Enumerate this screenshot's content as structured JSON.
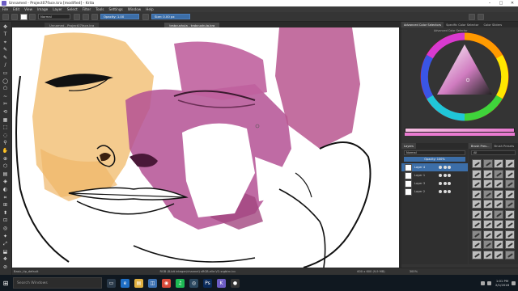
{
  "window": {
    "title": "Unnamed - Project07face.kra [modified] - Krita",
    "minimize": "–",
    "maximize": "□",
    "close": "✕"
  },
  "menu": [
    "File",
    "Edit",
    "View",
    "Image",
    "Layer",
    "Select",
    "Filter",
    "Tools",
    "Settings",
    "Window",
    "Help"
  ],
  "options": {
    "blend_mode": "Normal",
    "opacity": "Opacity: 1.00",
    "size": "Size: 0.00 px"
  },
  "tools": [
    "✥",
    "T",
    "⌖",
    "✎",
    "✎",
    "/",
    "▭",
    "◯",
    "⬠",
    "~",
    "✂",
    "⟲",
    "▦",
    "⬚",
    "◌",
    "⚲",
    "✋",
    "⊕",
    "⬡",
    "▤",
    "◈",
    "◐",
    "⌗",
    "⊞",
    "⬍",
    "⊡",
    "◎",
    "✦",
    "⤢",
    "⬓",
    "❖",
    "⊘"
  ],
  "doc_tabs": [
    "Unnamed - Project07face.kra",
    "trabcushula - trabcushula.kra"
  ],
  "status": {
    "brush": "Basic_tip_default",
    "color": "RGB (8-bit integer/channel) sRGB-elle-V2-srgbtrc.icc",
    "dims": "600 x 600 (9,9 MB)",
    "zoom": "300%"
  },
  "color_dock": {
    "tabs": [
      "Advanced Color Selectors",
      "Specific Color Selector",
      "Color Sliders"
    ],
    "active_tab_label": "Advanced Color Selector"
  },
  "layers_dock": {
    "tabs": [
      "Layers"
    ],
    "blend": "Normal",
    "opacity": "Opacity: 100%",
    "layers": [
      {
        "name": "Layer 4",
        "selected": true
      },
      {
        "name": "Layer 1",
        "selected": false
      },
      {
        "name": "Layer 3",
        "selected": false
      },
      {
        "name": "Layer 2",
        "selected": false
      }
    ]
  },
  "brush_dock": {
    "tabs": [
      "Brush Pres...",
      "Brush Presets"
    ],
    "tag": "All"
  },
  "taskbar": {
    "search_placeholder": "Search Windows",
    "time": "1:01 PM",
    "date": "2/1/2018"
  },
  "colors": {
    "accent": "#3c6ea8",
    "paint_magenta": "#b45194",
    "paint_skin": "#f2c27a"
  }
}
